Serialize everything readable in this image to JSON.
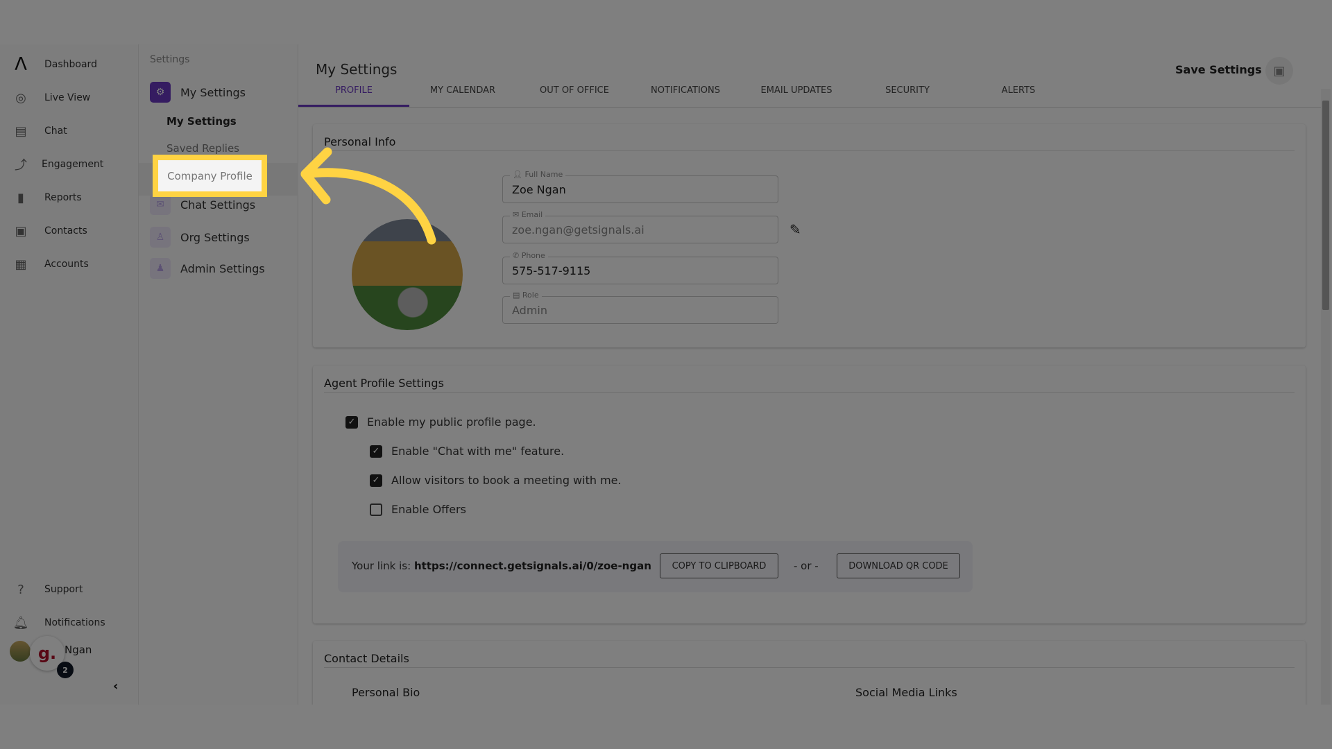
{
  "nav": {
    "items": [
      {
        "label": "Dashboard",
        "icon": "logo-icon"
      },
      {
        "label": "Live View",
        "icon": "live-view-icon"
      },
      {
        "label": "Chat",
        "icon": "chat-icon"
      },
      {
        "label": "Engagement",
        "icon": "engagement-icon"
      },
      {
        "label": "Reports",
        "icon": "bar-chart-icon"
      },
      {
        "label": "Contacts",
        "icon": "contacts-icon"
      },
      {
        "label": "Accounts",
        "icon": "building-icon"
      }
    ],
    "bottom": [
      {
        "label": "Support",
        "icon": "help-icon"
      },
      {
        "label": "Notifications",
        "icon": "bell-icon"
      }
    ],
    "user": {
      "name": "Ngan",
      "badge": "2",
      "widget_letter": "g."
    }
  },
  "settings_nav": {
    "header": "Settings",
    "items": [
      {
        "label": "My Settings"
      },
      {
        "label": "Chat Settings"
      },
      {
        "label": "Org Settings"
      },
      {
        "label": "Admin Settings"
      }
    ],
    "sub_items": [
      {
        "label": "My Settings",
        "active": true
      },
      {
        "label": "Saved Replies"
      },
      {
        "label": "Company Profile",
        "highlighted": true
      }
    ]
  },
  "main": {
    "title": "My Settings",
    "save_label": "Save Settings",
    "tabs": [
      "PROFILE",
      "MY CALENDAR",
      "OUT OF OFFICE",
      "NOTIFICATIONS",
      "EMAIL UPDATES",
      "SECURITY",
      "ALERTS"
    ],
    "active_tab": "PROFILE",
    "personal_info": {
      "title": "Personal Info",
      "fields": [
        {
          "label": "Full Name",
          "value": "Zoe Ngan"
        },
        {
          "label": "Email",
          "value": "zoe.ngan@getsignals.ai"
        },
        {
          "label": "Phone",
          "value": "575-517-9115"
        },
        {
          "label": "Role",
          "value": "Admin"
        }
      ]
    },
    "agent_profile": {
      "title": "Agent Profile Settings",
      "options": [
        {
          "label": "Enable my public profile page.",
          "checked": true
        },
        {
          "label": "Enable \"Chat with me\" feature.",
          "checked": true
        },
        {
          "label": "Allow visitors to book a meeting with me.",
          "checked": true
        },
        {
          "label": "Enable Offers",
          "checked": false
        }
      ],
      "link_prefix": "Your link is:",
      "link": "https://connect.getsignals.ai/0/zoe-ngan",
      "copy_label": "COPY TO CLIPBOARD",
      "or_label": "- or -",
      "qr_label": "DOWNLOAD QR CODE"
    },
    "contact_details": {
      "title": "Contact Details",
      "bio_label": "Personal Bio",
      "social_label": "Social Media Links"
    }
  },
  "colors": {
    "accent": "#6a38c2",
    "highlight": "#ffd343"
  }
}
